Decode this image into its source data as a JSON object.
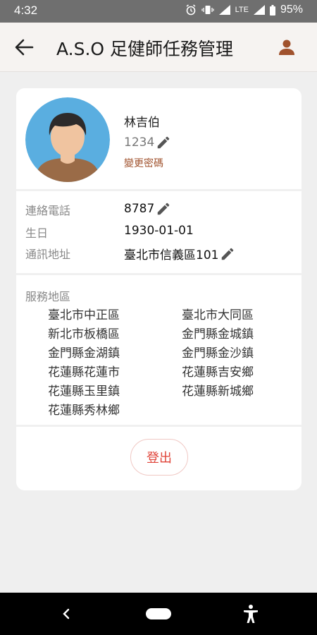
{
  "status_bar": {
    "time": "4:32",
    "network": "LTE",
    "battery": "95%"
  },
  "app_bar": {
    "title": "A.S.O 足健師任務管理"
  },
  "profile": {
    "name": "林吉伯",
    "id": "1234",
    "change_password": "變更密碼"
  },
  "info": [
    {
      "label": "連絡電話",
      "value": "8787",
      "editable": true
    },
    {
      "label": "生日",
      "value": "1930-01-01",
      "editable": false
    },
    {
      "label": "通訊地址",
      "value": "臺北市信義區101",
      "editable": true
    }
  ],
  "service_areas": {
    "title": "服務地區",
    "items": [
      "臺北市中正區",
      "臺北市大同區",
      "新北市板橋區",
      "金門縣金城鎮",
      "金門縣金湖鎮",
      "金門縣金沙鎮",
      "花蓮縣花蓮市",
      "花蓮縣吉安鄉",
      "花蓮縣玉里鎮",
      "花蓮縣新城鄉",
      "花蓮縣秀林鄉"
    ]
  },
  "logout_label": "登出",
  "colors": {
    "accent": "#a0522d",
    "logout": "#e0453a",
    "avatar_bg": "#5aaee0"
  }
}
